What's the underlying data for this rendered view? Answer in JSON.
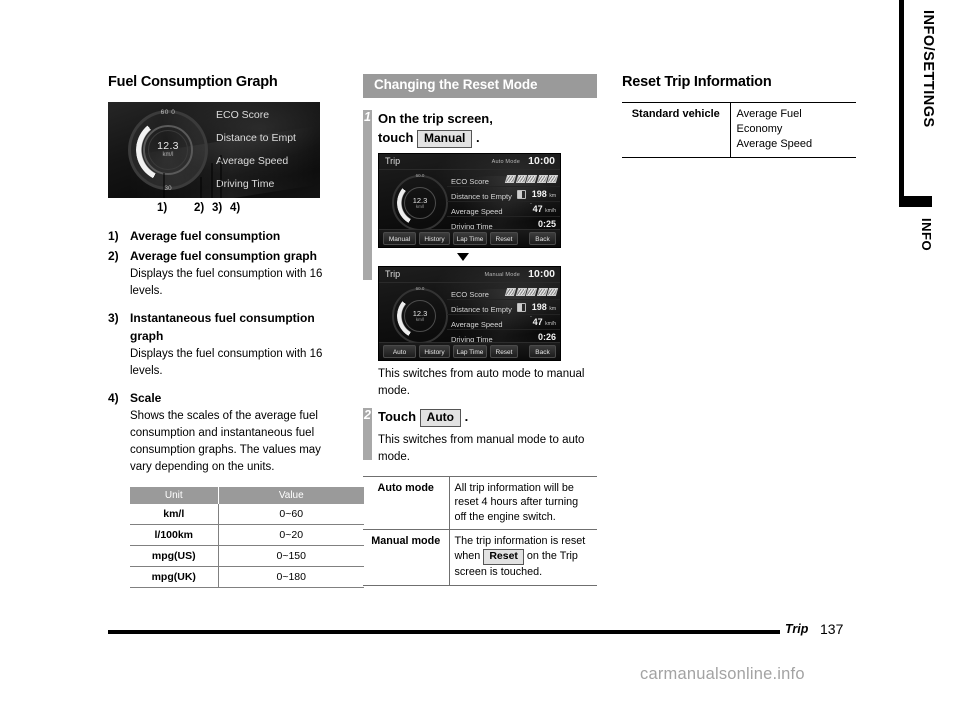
{
  "left": {
    "heading": "Fuel Consumption Graph",
    "gauge_image": {
      "dial_value": "12.3",
      "dial_unit": "km/l",
      "scale_top": "60 0",
      "scale_bottom": "30",
      "menu_items": [
        "ECO Score",
        "Distance to Empt",
        "Average Speed",
        "Driving Time"
      ]
    },
    "callout_numbers": [
      "1)",
      "2)",
      "3)",
      "4)"
    ],
    "items": [
      {
        "num": "1)",
        "term": "Average fuel consumption",
        "desc": ""
      },
      {
        "num": "2)",
        "term": "Average fuel consumption graph",
        "desc": "Displays the fuel consumption with 16 levels."
      },
      {
        "num": "3)",
        "term": "Instantaneous fuel consumption graph",
        "desc": "Displays the fuel consumption with 16 levels."
      },
      {
        "num": "4)",
        "term": "Scale",
        "desc": "Shows the scales of the average fuel consumption and instantaneous fuel consumption graphs. The values may vary depending on the units."
      }
    ],
    "scale_table": {
      "headers": [
        "Unit",
        "Value"
      ],
      "rows": [
        [
          "km/l",
          "0~60"
        ],
        [
          "l/100km",
          "0~20"
        ],
        [
          "mpg(US)",
          "0~150"
        ],
        [
          "mpg(UK)",
          "0~180"
        ]
      ]
    }
  },
  "middle": {
    "section_title": "Changing the Reset Mode",
    "step1": {
      "number": "1",
      "title_line1": "On the trip screen,",
      "title_line2_prefix": "touch",
      "title_key": "Manual",
      "title_line2_suffix": ".",
      "after_text": "This switches from auto mode to manual mode."
    },
    "step2": {
      "number": "2",
      "title_prefix": "Touch",
      "title_key": "Auto",
      "title_suffix": ".",
      "after_text": "This switches from manual mode to auto mode."
    },
    "trip_screen_auto": {
      "title": "Trip",
      "mode": "Auto Mode",
      "clock": "10:00",
      "dial_value": "12.3",
      "dial_unit": "km/l",
      "dial_max": "60.0",
      "dial_min": "30",
      "rows": [
        {
          "label": "ECO Score",
          "value": "",
          "unit": ""
        },
        {
          "label": "Distance to Empty",
          "value": "198",
          "unit": "km"
        },
        {
          "label": "Average Speed",
          "value": "47",
          "unit": "km/h"
        },
        {
          "label": "Driving Time",
          "value": "0:25",
          "unit": ""
        }
      ],
      "buttons": [
        "Manual",
        "History",
        "Lap Time",
        "Reset"
      ],
      "back_button": "Back"
    },
    "trip_screen_manual": {
      "title": "Trip",
      "mode": "Manual Mode",
      "clock": "10:00",
      "dial_value": "12.3",
      "dial_unit": "km/l",
      "dial_max": "60.0",
      "dial_min": "30",
      "rows": [
        {
          "label": "ECO Score",
          "value": "",
          "unit": ""
        },
        {
          "label": "Distance to Empty",
          "value": "198",
          "unit": "km"
        },
        {
          "label": "Average Speed",
          "value": "47",
          "unit": "km/h"
        },
        {
          "label": "Driving Time",
          "value": "0:26",
          "unit": ""
        }
      ],
      "buttons": [
        "Auto",
        "History",
        "Lap Time",
        "Reset"
      ],
      "back_button": "Back"
    },
    "mode_table": {
      "rows": [
        {
          "key": "Auto mode",
          "text": "All trip information will be reset 4 hours after turning off the engine switch."
        },
        {
          "key": "Manual mode",
          "text_before": "The trip information is reset when",
          "key_button": "Reset",
          "text_after": "on the Trip screen is touched."
        }
      ]
    }
  },
  "right": {
    "heading": "Reset Trip Information",
    "table": {
      "rows": [
        {
          "key": "Standard vehicle",
          "value_line1": "Average Fuel Economy",
          "value_line2": "Average Speed"
        }
      ]
    }
  },
  "side_tab": {
    "main": "INFO/SETTINGS",
    "sub": "INFO"
  },
  "footer": {
    "chapter": "Trip",
    "page": "137",
    "watermark": "carmanualsonline.info"
  }
}
